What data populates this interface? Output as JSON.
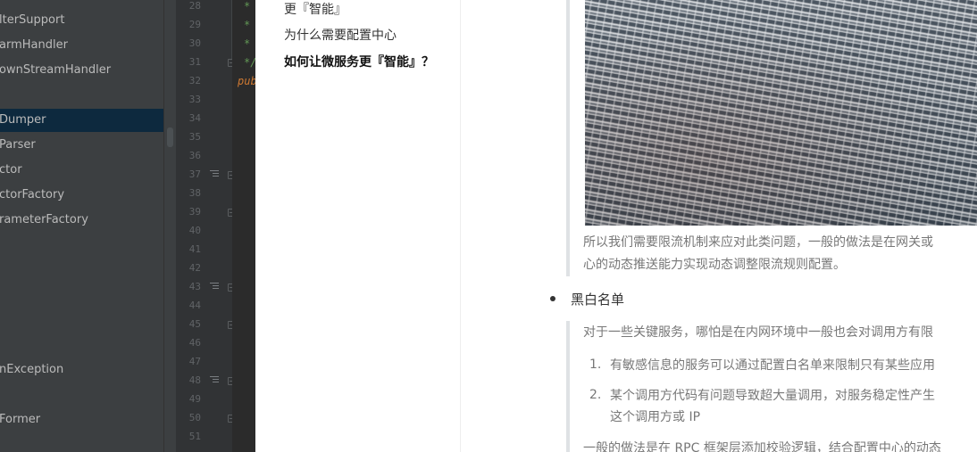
{
  "ide": {
    "tree_items": [
      {
        "label": "lterSupport",
        "selected": false
      },
      {
        "label": "armHandler",
        "selected": false
      },
      {
        "label": "ownStreamHandler",
        "selected": false
      },
      {
        "label": "Dumper",
        "selected": true
      },
      {
        "label": "Parser",
        "selected": false
      },
      {
        "label": "ctor",
        "selected": false
      },
      {
        "label": "ctorFactory",
        "selected": false
      },
      {
        "label": "rameterFactory",
        "selected": false
      },
      {
        "label": "nException",
        "selected": false
      },
      {
        "label": "Former",
        "selected": false
      }
    ],
    "line_numbers": [
      "28",
      "29",
      "30",
      "31",
      "32",
      "33",
      "34",
      "35",
      "36",
      "37",
      "38",
      "39",
      "40",
      "41",
      "42",
      "43",
      "44",
      "45",
      "46",
      "47",
      "48",
      "49",
      "50",
      "51"
    ],
    "code_lines": [
      {
        "text": "*",
        "kind": "comment"
      },
      {
        "text": "*",
        "kind": "comment"
      },
      {
        "text": "*",
        "kind": "comment"
      },
      {
        "text": "*/",
        "kind": "comment"
      },
      {
        "text": "pub",
        "kind": "keyword"
      }
    ]
  },
  "toc": {
    "items": [
      {
        "label": "更『智能』",
        "active": false
      },
      {
        "label": "为什么需要配置中心",
        "active": false
      },
      {
        "label": "如何让微服务更『智能』？",
        "active": true
      }
    ]
  },
  "article": {
    "quote1_line1": "所以我们需要限流机制来应对此类问题，一般的做法是在网关或",
    "quote1_line2": "心的动态推送能力实现动态调整限流规则配置。",
    "bullet": "黑白名单",
    "quote2_intro": "对于一些关键服务，哪怕是在内网环境中一般也会对调用方有限",
    "list": [
      {
        "num": "1.",
        "lines": [
          "有敏感信息的服务可以通过配置白名单来限制只有某些应用"
        ]
      },
      {
        "num": "2.",
        "lines": [
          "某个调用方代码有问题导致超大量调用，对服务稳定性产生",
          "这个调用方或 IP"
        ]
      }
    ],
    "quote2_tail": "一般的做法是在 RPC 框架层添加校验逻辑，结合配置中心的动态"
  }
}
